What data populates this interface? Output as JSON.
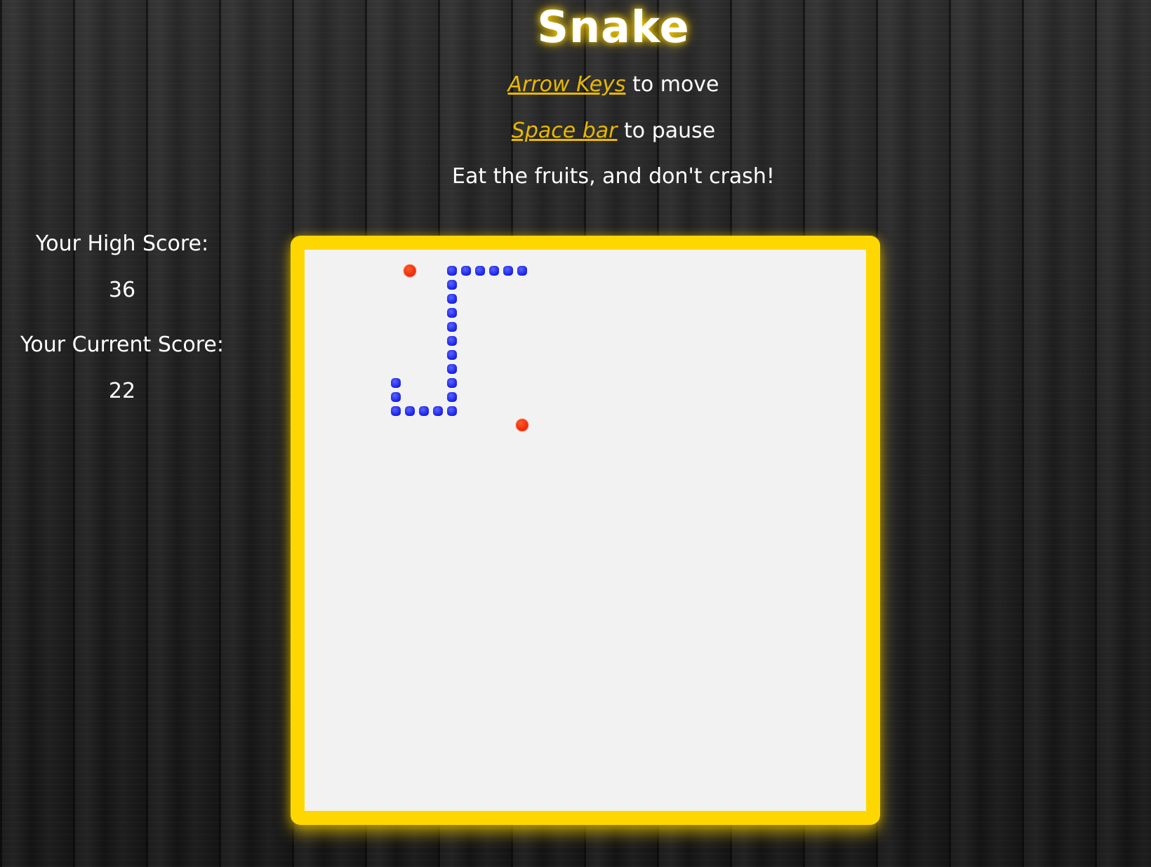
{
  "header": {
    "title": "Snake"
  },
  "instructions": {
    "move_key": "Arrow Keys",
    "move_text": " to move",
    "pause_key": "Space bar",
    "pause_text": " to pause",
    "goal_text": "Eat the fruits, and don't crash!"
  },
  "scoreboard": {
    "high_score_label": "Your High Score:",
    "high_score": "36",
    "current_score_label": "Your Current Score:",
    "current_score": "22"
  },
  "game": {
    "grid_size": 40,
    "snake_color": "#1a23f5",
    "fruit_color": "#ff2a00",
    "board_color": "#f2f2f2",
    "border_color": "#ffd700",
    "snake": [
      [
        15,
        1
      ],
      [
        14,
        1
      ],
      [
        13,
        1
      ],
      [
        12,
        1
      ],
      [
        11,
        1
      ],
      [
        10,
        1
      ],
      [
        10,
        2
      ],
      [
        10,
        3
      ],
      [
        10,
        4
      ],
      [
        10,
        5
      ],
      [
        10,
        6
      ],
      [
        10,
        7
      ],
      [
        10,
        8
      ],
      [
        10,
        9
      ],
      [
        10,
        10
      ],
      [
        10,
        11
      ],
      [
        9,
        11
      ],
      [
        8,
        11
      ],
      [
        7,
        11
      ],
      [
        6,
        11
      ],
      [
        6,
        10
      ],
      [
        6,
        9
      ]
    ],
    "fruits": [
      [
        7,
        1
      ],
      [
        15,
        12
      ]
    ]
  }
}
